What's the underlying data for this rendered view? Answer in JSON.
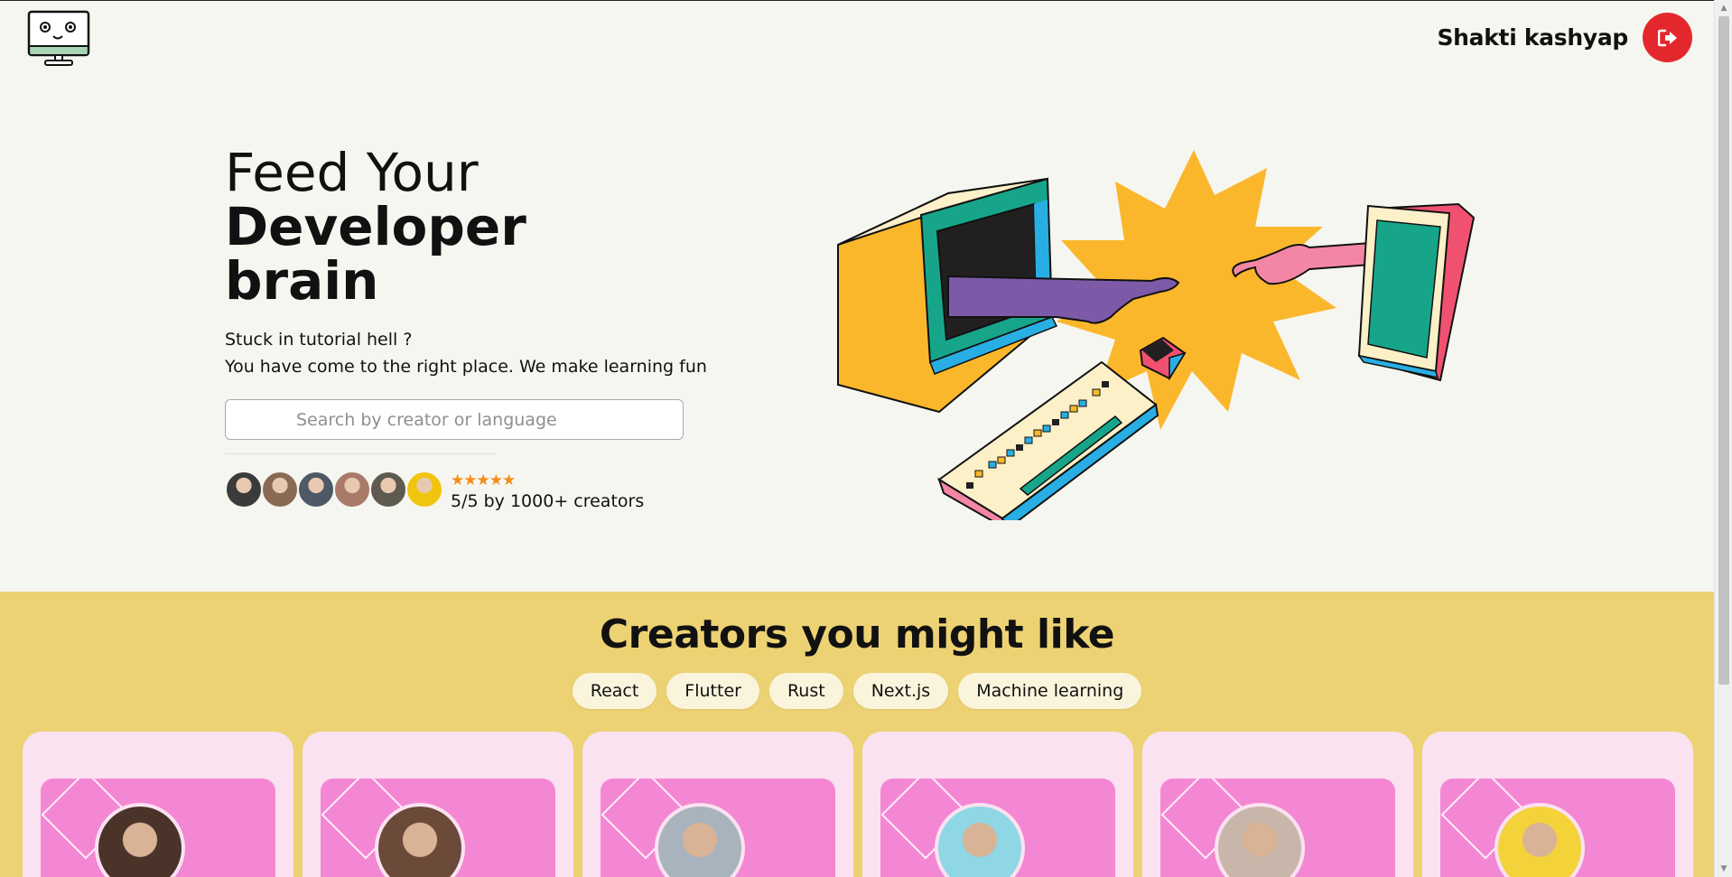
{
  "header": {
    "logo_icon": "monitor-face-icon",
    "user_name": "Shakti kashyap",
    "logout_icon": "logout-icon"
  },
  "hero": {
    "title_line1": "Feed Your",
    "title_line2": "Developer",
    "title_line3": "brain",
    "subtitle_line1": "Stuck in tutorial hell ?",
    "subtitle_line2": "You have come to the right place. We make learning fun",
    "search_placeholder": "Search by creator or language",
    "stars": "★★★★★",
    "rating_text": "5/5 by 1000+ creators",
    "avatar_colors": [
      "#3b3b3b",
      "#8a6a55",
      "#4d5a66",
      "#a97a6a",
      "#5e5a4f",
      "#f1c40f"
    ]
  },
  "creators": {
    "title_regular": "Creators",
    "title_bold": "you might like",
    "tags": [
      "React",
      "Flutter",
      "Rust",
      "Next.js",
      "Machine learning"
    ],
    "card_avatar_colors": [
      "#4a3328",
      "#6b4a3a",
      "#a8b3bd",
      "#8fd7e5",
      "#c9b6aa",
      "#f4d23a"
    ]
  },
  "colors": {
    "page_bg": "#f6f6f1",
    "section_bg": "#edd274",
    "logout_red": "#e3282d",
    "card_bg": "#fbe2f1",
    "card_banner": "#f487d4",
    "star_orange": "#f28d17"
  }
}
